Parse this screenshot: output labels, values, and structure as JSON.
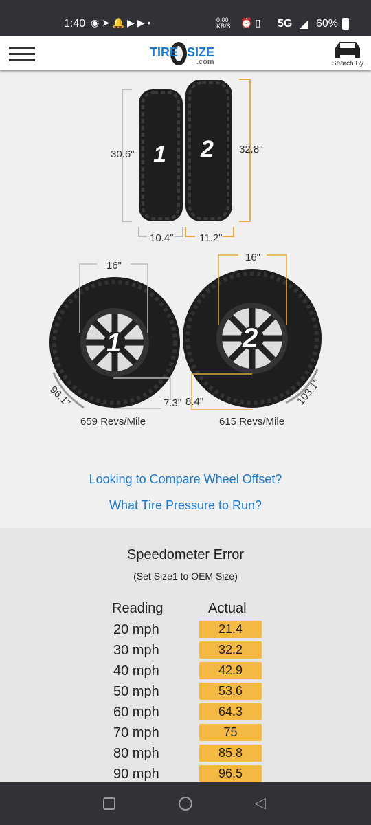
{
  "status_bar": {
    "time": "1:40",
    "net_speed": "0.00 KB/S",
    "network": "5G",
    "battery": "60%"
  },
  "header": {
    "logo_text": "TIRESIZE",
    "logo_sub": ".com",
    "search_by": "Search By"
  },
  "side_view": {
    "tire1_label": "1",
    "tire2_label": "2",
    "tire1_height": "30.6\"",
    "tire2_height": "32.8\"",
    "tire1_width": "10.4\"",
    "tire2_width": "11.2\""
  },
  "front_view": {
    "tire1_rim": "16\"",
    "tire2_rim": "16\"",
    "tire1_circ": "96.1\"",
    "tire2_circ": "103.1\"",
    "tire1_sidewall": "7.3\"",
    "tire2_sidewall": "8.4\"",
    "tire1_revs": "659 Revs/Mile",
    "tire2_revs": "615 Revs/Mile"
  },
  "links": {
    "offset": "Looking to Compare Wheel Offset?",
    "pressure": "What Tire Pressure to Run?"
  },
  "speedometer": {
    "title": "Speedometer Error",
    "subtitle": "(Set Size1 to OEM Size)",
    "col_reading": "Reading",
    "col_actual": "Actual",
    "rows": [
      {
        "reading": "20 mph",
        "actual": "21.4"
      },
      {
        "reading": "30 mph",
        "actual": "32.2"
      },
      {
        "reading": "40 mph",
        "actual": "42.9"
      },
      {
        "reading": "50 mph",
        "actual": "53.6"
      },
      {
        "reading": "60 mph",
        "actual": "64.3"
      },
      {
        "reading": "70 mph",
        "actual": "75"
      },
      {
        "reading": "80 mph",
        "actual": "85.8"
      },
      {
        "reading": "90 mph",
        "actual": "96.5"
      }
    ]
  },
  "colors": {
    "accent": "#f4b942",
    "link": "#1f7ac9",
    "size2_lines": "#e8a93a"
  }
}
